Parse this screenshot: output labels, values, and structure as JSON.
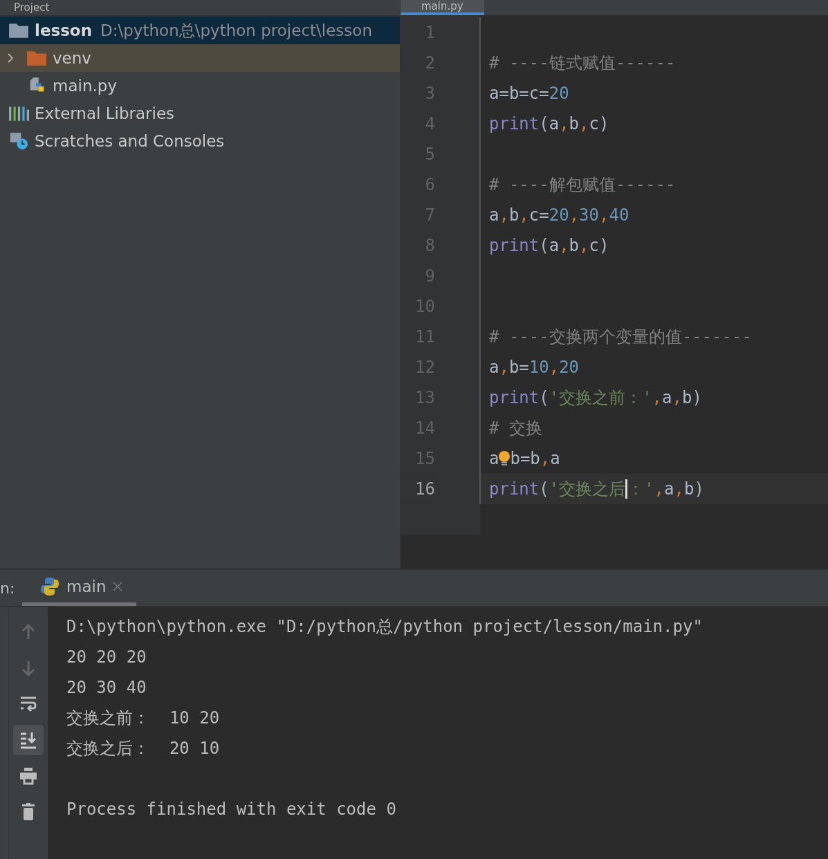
{
  "project_panel": {
    "title": "Project",
    "tree": [
      {
        "kind": "root",
        "name": "lesson",
        "path": "D:\\python总\\python project\\lesson",
        "selected": true,
        "children": [
          {
            "kind": "folder",
            "name": "venv",
            "selected": false,
            "highlighted": true,
            "expanded": false
          },
          {
            "kind": "pyfile",
            "name": "main.py",
            "selected": false,
            "highlighted": false
          }
        ]
      },
      {
        "kind": "libraries",
        "name": "External Libraries",
        "selected": false
      },
      {
        "kind": "scratches",
        "name": "Scratches and Consoles",
        "selected": false
      }
    ]
  },
  "editor": {
    "tabs": [
      {
        "label": "main.py",
        "selected": true
      }
    ],
    "lines": [
      {
        "number": "1",
        "current": false
      },
      {
        "number": "2",
        "current": false,
        "segments": [
          {
            "kind": "comment",
            "text": "# ----链式赋值------"
          }
        ]
      },
      {
        "number": "3",
        "current": false,
        "segments": [
          {
            "kind": "plain",
            "text": "a=b=c="
          },
          {
            "kind": "number",
            "text": "20"
          }
        ]
      },
      {
        "number": "4",
        "current": false,
        "segments": [
          {
            "kind": "builtin",
            "text": "print"
          },
          {
            "kind": "plain",
            "text": "(a"
          },
          {
            "kind": "comma",
            "text": ","
          },
          {
            "kind": "plain",
            "text": "b"
          },
          {
            "kind": "comma",
            "text": ","
          },
          {
            "kind": "plain",
            "text": "c)"
          }
        ]
      },
      {
        "number": "5",
        "current": false
      },
      {
        "number": "6",
        "current": false,
        "segments": [
          {
            "kind": "comment",
            "text": "# ----解包赋值------"
          }
        ]
      },
      {
        "number": "7",
        "current": false,
        "segments": [
          {
            "kind": "plain",
            "text": "a"
          },
          {
            "kind": "comma",
            "text": ","
          },
          {
            "kind": "plain",
            "text": "b"
          },
          {
            "kind": "comma",
            "text": ","
          },
          {
            "kind": "plain",
            "text": "c="
          },
          {
            "kind": "number",
            "text": "20"
          },
          {
            "kind": "comma",
            "text": ","
          },
          {
            "kind": "number",
            "text": "30"
          },
          {
            "kind": "comma",
            "text": ","
          },
          {
            "kind": "number",
            "text": "40"
          }
        ]
      },
      {
        "number": "8",
        "current": false,
        "segments": [
          {
            "kind": "builtin",
            "text": "print"
          },
          {
            "kind": "plain",
            "text": "(a"
          },
          {
            "kind": "comma",
            "text": ","
          },
          {
            "kind": "plain",
            "text": "b"
          },
          {
            "kind": "comma",
            "text": ","
          },
          {
            "kind": "plain",
            "text": "c)"
          }
        ]
      },
      {
        "number": "9",
        "current": false
      },
      {
        "number": "10",
        "current": false
      },
      {
        "number": "11",
        "current": false,
        "segments": [
          {
            "kind": "comment",
            "text": "# ----交换两个变量的值-------"
          }
        ]
      },
      {
        "number": "12",
        "current": false,
        "segments": [
          {
            "kind": "plain",
            "text": "a"
          },
          {
            "kind": "comma",
            "text": ","
          },
          {
            "kind": "plain",
            "text": "b="
          },
          {
            "kind": "number",
            "text": "10"
          },
          {
            "kind": "comma",
            "text": ","
          },
          {
            "kind": "number",
            "text": "20"
          }
        ]
      },
      {
        "number": "13",
        "current": false,
        "segments": [
          {
            "kind": "builtin",
            "text": "print"
          },
          {
            "kind": "plain",
            "text": "("
          },
          {
            "kind": "string",
            "text": "'交换之前：'"
          },
          {
            "kind": "comma",
            "text": ","
          },
          {
            "kind": "plain",
            "text": "a"
          },
          {
            "kind": "comma",
            "text": ","
          },
          {
            "kind": "plain",
            "text": "b)"
          }
        ]
      },
      {
        "number": "14",
        "current": false,
        "segments": [
          {
            "kind": "comment",
            "text": "# 交换"
          }
        ]
      },
      {
        "number": "15",
        "current": false,
        "segments": [
          {
            "kind": "plain",
            "text": "a"
          },
          {
            "kind": "bulb"
          },
          {
            "kind": "plain",
            "text": "b=b"
          },
          {
            "kind": "comma",
            "text": ","
          },
          {
            "kind": "plain",
            "text": "a"
          }
        ]
      },
      {
        "number": "16",
        "current": true,
        "segments": [
          {
            "kind": "builtin",
            "text": "print"
          },
          {
            "kind": "plain",
            "text": "("
          },
          {
            "kind": "string",
            "text": "'交换之后"
          },
          {
            "kind": "caret"
          },
          {
            "kind": "string",
            "text": "：'"
          },
          {
            "kind": "comma",
            "text": ","
          },
          {
            "kind": "plain",
            "text": "a"
          },
          {
            "kind": "comma",
            "text": ","
          },
          {
            "kind": "plain",
            "text": "b)"
          }
        ]
      }
    ]
  },
  "run_panel": {
    "label": "n:",
    "tabs": [
      {
        "label": "main",
        "selected": true
      }
    ],
    "output": [
      {
        "kind": "text",
        "text": "D:\\python\\python.exe \"D:/python总/python project/lesson/main.py\""
      },
      {
        "kind": "text",
        "text": "20 20 20"
      },
      {
        "kind": "text",
        "text": "20 30 40"
      },
      {
        "kind": "text",
        "text": "交换之前：  10 20"
      },
      {
        "kind": "text",
        "text": "交换之后：  20 10"
      },
      {
        "kind": "blank"
      },
      {
        "kind": "text",
        "text": "Process finished with exit code 0"
      }
    ],
    "tools": [
      {
        "kind": "up",
        "on": false
      },
      {
        "kind": "down",
        "on": false
      },
      {
        "kind": "wrap",
        "on": false
      },
      {
        "kind": "scroll-end",
        "on": true
      },
      {
        "kind": "print",
        "on": false
      },
      {
        "kind": "trash",
        "on": false
      }
    ]
  }
}
